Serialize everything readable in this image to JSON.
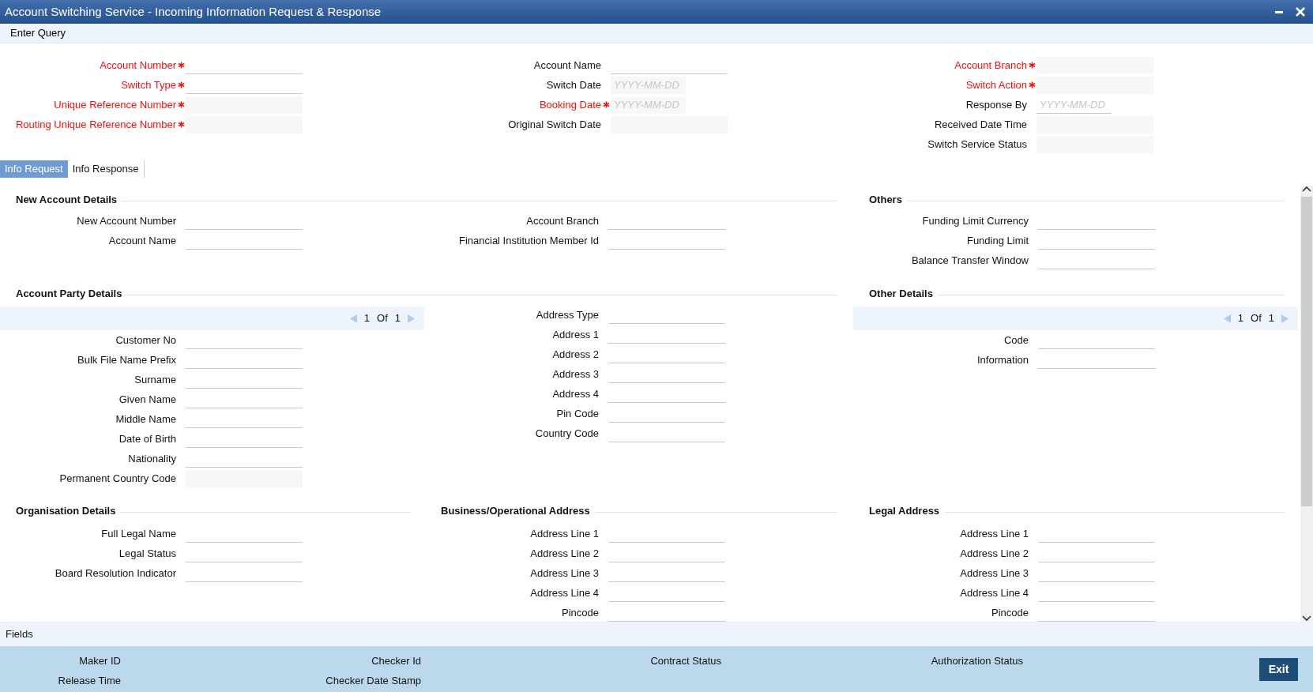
{
  "window": {
    "title": "Account Switching Service - Incoming Information Request & Response"
  },
  "toolbar": {
    "items": [
      "Enter Query"
    ]
  },
  "header_columns": [
    [
      {
        "label": "Account Number",
        "required": true,
        "kind": "text",
        "disabled": false
      },
      {
        "label": "Switch Type",
        "required": true,
        "kind": "text",
        "disabled": false
      },
      {
        "label": "Unique Reference Number",
        "required": true,
        "kind": "text",
        "disabled": true
      },
      {
        "label": "Routing Unique Reference Number",
        "required": true,
        "kind": "text",
        "disabled": true
      }
    ],
    [
      {
        "label": "Account Name",
        "required": false,
        "kind": "text",
        "disabled": false
      },
      {
        "label": "Switch Date",
        "required": false,
        "kind": "date",
        "disabled": true,
        "placeholder": "YYYY-MM-DD"
      },
      {
        "label": "Booking Date",
        "required": true,
        "kind": "date",
        "disabled": true,
        "placeholder": "YYYY-MM-DD"
      },
      {
        "label": "Original Switch Date",
        "required": false,
        "kind": "text",
        "disabled": true
      }
    ],
    [
      {
        "label": "Account Branch",
        "required": true,
        "kind": "text",
        "disabled": true
      },
      {
        "label": "Switch Action",
        "required": true,
        "kind": "text",
        "disabled": true
      },
      {
        "label": "Response By",
        "required": false,
        "kind": "date",
        "disabled": false,
        "placeholder": "YYYY-MM-DD"
      },
      {
        "label": "Received Date Time",
        "required": false,
        "kind": "text",
        "disabled": true
      },
      {
        "label": "Switch Service Status",
        "required": false,
        "kind": "text",
        "disabled": true
      }
    ]
  ],
  "tabs": [
    {
      "label": "Info Request",
      "selected": true
    },
    {
      "label": "Info Response",
      "selected": false
    }
  ],
  "section_rows": [
    [
      {
        "title": "New Account Details",
        "columns": [
          {
            "fields": [
              {
                "label": "New Account Number",
                "disabled": false
              },
              {
                "label": "Account Name",
                "disabled": false
              }
            ]
          },
          {
            "fields": [
              {
                "label": "Account Branch",
                "disabled": false
              },
              {
                "label": "Financial Institution Member Id",
                "disabled": false
              }
            ]
          }
        ]
      },
      {
        "title": "Others",
        "columns": [
          {
            "fields": [
              {
                "label": "Funding Limit Currency",
                "disabled": false
              },
              {
                "label": "Funding Limit",
                "disabled": false
              },
              {
                "label": "Balance Transfer Window",
                "disabled": false
              }
            ]
          }
        ]
      }
    ],
    [
      {
        "title": "Account Party Details",
        "columns": [
          {
            "pager": {
              "current": "1",
              "of": "Of",
              "total": "1"
            },
            "fields": [
              {
                "label": "Customer No",
                "disabled": false
              },
              {
                "label": "Bulk File Name Prefix",
                "disabled": false
              },
              {
                "label": "Surname",
                "disabled": false
              },
              {
                "label": "Given Name",
                "disabled": false
              },
              {
                "label": "Middle Name",
                "disabled": false
              },
              {
                "label": "Date of Birth",
                "disabled": false
              },
              {
                "label": "Nationality",
                "disabled": false
              },
              {
                "label": "Permanent Country Code",
                "disabled": true
              }
            ]
          },
          {
            "fields": [
              {
                "label": "Address Type",
                "disabled": false
              },
              {
                "label": "Address 1",
                "disabled": false
              },
              {
                "label": "Address 2",
                "disabled": false
              },
              {
                "label": "Address 3",
                "disabled": false
              },
              {
                "label": "Address 4",
                "disabled": false
              },
              {
                "label": "Pin Code",
                "disabled": false
              },
              {
                "label": "Country Code",
                "disabled": false
              }
            ]
          }
        ]
      },
      {
        "title": "Other Details",
        "columns": [
          {
            "pager": {
              "current": "1",
              "of": "Of",
              "total": "1"
            },
            "fields": [
              {
                "label": "Code",
                "disabled": false
              },
              {
                "label": "Information",
                "disabled": false
              }
            ]
          }
        ]
      }
    ],
    [
      {
        "title": "Organisation Details",
        "columns": [
          {
            "fields": [
              {
                "label": "Full Legal Name",
                "disabled": false
              },
              {
                "label": "Legal Status",
                "disabled": false
              },
              {
                "label": "Board Resolution Indicator",
                "disabled": false
              }
            ]
          }
        ]
      },
      {
        "title": "Business/Operational Address",
        "columns": [
          {
            "fields": [
              {
                "label": "Address Line 1",
                "disabled": false
              },
              {
                "label": "Address Line 2",
                "disabled": false
              },
              {
                "label": "Address Line 3",
                "disabled": false
              },
              {
                "label": "Address Line 4",
                "disabled": false
              },
              {
                "label": "Pincode",
                "disabled": false
              }
            ]
          }
        ]
      },
      {
        "title": "Legal Address",
        "columns": [
          {
            "fields": [
              {
                "label": "Address Line 1",
                "disabled": false
              },
              {
                "label": "Address Line 2",
                "disabled": false
              },
              {
                "label": "Address Line 3",
                "disabled": false
              },
              {
                "label": "Address Line 4",
                "disabled": false
              },
              {
                "label": "Pincode",
                "disabled": false
              }
            ]
          }
        ]
      }
    ]
  ],
  "fields_bar": {
    "label": "Fields"
  },
  "audit_columns": [
    [
      "Maker ID",
      "Release Time"
    ],
    [
      "Checker Id",
      "Checker Date Stamp"
    ],
    [
      "Contract Status"
    ],
    [
      "Authorization Status"
    ]
  ],
  "exit_button": {
    "label": "Exit"
  }
}
